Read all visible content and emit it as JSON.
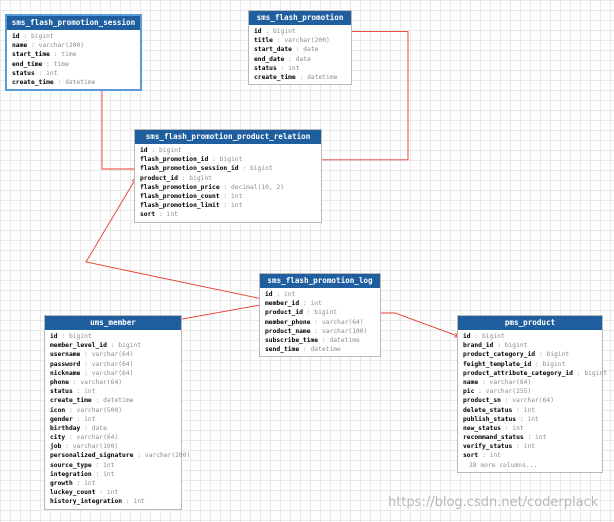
{
  "tables": [
    {
      "id": "session",
      "name": "sms_flash_promotion_session",
      "selected": true,
      "columns": [
        {
          "name": "id",
          "type": "bigint"
        },
        {
          "name": "name",
          "type": "varchar(200)"
        },
        {
          "name": "start_time",
          "type": "time"
        },
        {
          "name": "end_time",
          "type": "time"
        },
        {
          "name": "status",
          "type": "int"
        },
        {
          "name": "create_time",
          "type": "datetime"
        }
      ]
    },
    {
      "id": "promotion",
      "name": "sms_flash_promotion",
      "columns": [
        {
          "name": "id",
          "type": "bigint"
        },
        {
          "name": "title",
          "type": "varchar(200)"
        },
        {
          "name": "start_date",
          "type": "date"
        },
        {
          "name": "end_date",
          "type": "date"
        },
        {
          "name": "status",
          "type": "int"
        },
        {
          "name": "create_time",
          "type": "datetime"
        }
      ]
    },
    {
      "id": "relation",
      "name": "sms_flash_promotion_product_relation",
      "columns": [
        {
          "name": "id",
          "type": "bigint"
        },
        {
          "name": "flash_promotion_id",
          "type": "bigint"
        },
        {
          "name": "flash_promotion_session_id",
          "type": "bigint"
        },
        {
          "name": "product_id",
          "type": "bigint"
        },
        {
          "name": "flash_promotion_price",
          "type": "decimal(10, 2)"
        },
        {
          "name": "flash_promotion_count",
          "type": "int"
        },
        {
          "name": "flash_promotion_limit",
          "type": "int"
        },
        {
          "name": "sort",
          "type": "int"
        }
      ]
    },
    {
      "id": "log",
      "name": "sms_flash_promotion_log",
      "columns": [
        {
          "name": "id",
          "type": "int"
        },
        {
          "name": "member_id",
          "type": "int"
        },
        {
          "name": "product_id",
          "type": "bigint"
        },
        {
          "name": "member_phone",
          "type": "varchar(64)"
        },
        {
          "name": "product_name",
          "type": "varchar(100)"
        },
        {
          "name": "subscribe_time",
          "type": "datetime"
        },
        {
          "name": "send_time",
          "type": "datetime"
        }
      ]
    },
    {
      "id": "member",
      "name": "ums_member",
      "columns": [
        {
          "name": "id",
          "type": "bigint"
        },
        {
          "name": "member_level_id",
          "type": "bigint"
        },
        {
          "name": "username",
          "type": "varchar(64)"
        },
        {
          "name": "password",
          "type": "varchar(64)"
        },
        {
          "name": "nickname",
          "type": "varchar(64)"
        },
        {
          "name": "phone",
          "type": "varchar(64)"
        },
        {
          "name": "status",
          "type": "int"
        },
        {
          "name": "create_time",
          "type": "datetime"
        },
        {
          "name": "icon",
          "type": "varchar(500)"
        },
        {
          "name": "gender",
          "type": "int"
        },
        {
          "name": "birthday",
          "type": "date"
        },
        {
          "name": "city",
          "type": "varchar(64)"
        },
        {
          "name": "job",
          "type": "varchar(100)"
        },
        {
          "name": "personalized_signature",
          "type": "varchar(200)"
        },
        {
          "name": "source_type",
          "type": "int"
        },
        {
          "name": "integration",
          "type": "int"
        },
        {
          "name": "growth",
          "type": "int"
        },
        {
          "name": "luckey_count",
          "type": "int"
        },
        {
          "name": "history_integration",
          "type": "int"
        }
      ]
    },
    {
      "id": "product",
      "name": "pms_product",
      "more": "28 more columns...",
      "columns": [
        {
          "name": "id",
          "type": "bigint"
        },
        {
          "name": "brand_id",
          "type": "bigint"
        },
        {
          "name": "product_category_id",
          "type": "bigint"
        },
        {
          "name": "feight_template_id",
          "type": "bigint"
        },
        {
          "name": "product_attribute_category_id",
          "type": "bigint"
        },
        {
          "name": "name",
          "type": "varchar(64)"
        },
        {
          "name": "pic",
          "type": "varchar(255)"
        },
        {
          "name": "product_sn",
          "type": "varchar(64)"
        },
        {
          "name": "delete_status",
          "type": "int"
        },
        {
          "name": "publish_status",
          "type": "int"
        },
        {
          "name": "new_status",
          "type": "int"
        },
        {
          "name": "recommand_status",
          "type": "int"
        },
        {
          "name": "verify_status",
          "type": "int"
        },
        {
          "name": "sort",
          "type": "int"
        }
      ]
    }
  ],
  "relations": [
    {
      "from": "relation.flash_promotion_id",
      "to": "promotion.id"
    },
    {
      "from": "relation.flash_promotion_session_id",
      "to": "session.id"
    },
    {
      "from": "log.member_id",
      "to": "member.id"
    },
    {
      "from": "log.product_id",
      "to": "product.id"
    },
    {
      "from": "log.product_id",
      "to": "relation.product_id"
    }
  ],
  "edge_color": "#e8392c",
  "header_color": "#1f5fa0",
  "watermark": "https://blog.csdn.net/coderplack"
}
